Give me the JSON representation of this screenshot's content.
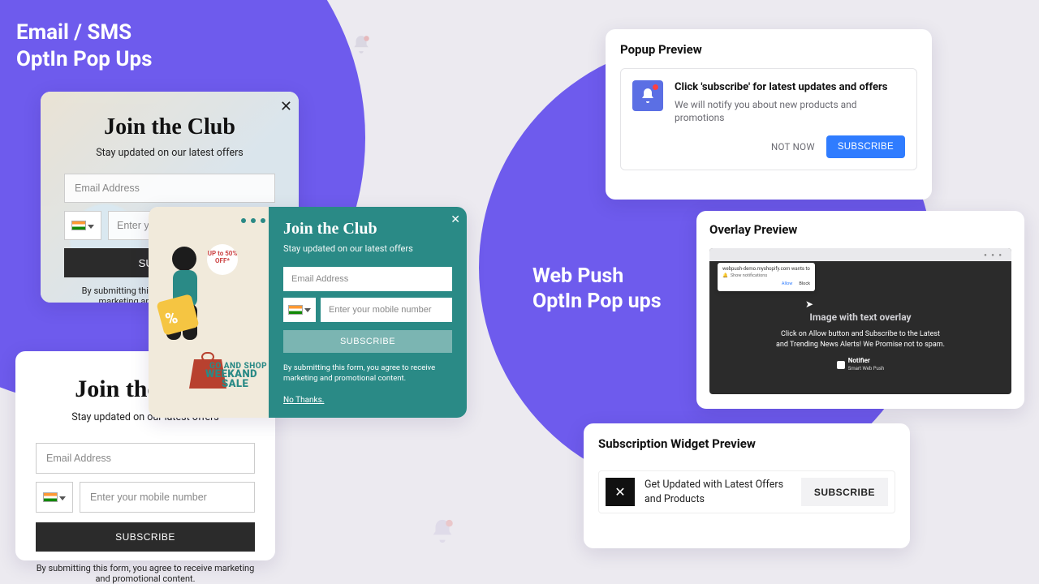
{
  "left_heading_l1": "Email / SMS",
  "left_heading_l2": "OptIn Pop Ups",
  "right_heading_l1": "Web Push",
  "right_heading_l2": "OptIn Pop ups",
  "popA": {
    "title": "Join the Club",
    "subtitle": "Stay updated on our latest offers",
    "email_ph": "Email Address",
    "phone_ph": "Enter your mobile number",
    "submit": "SUBSCRIBE",
    "terms": "By submitting this form, you agree to receive marketing and promotional content."
  },
  "popB": {
    "badge": "UP to 50% OFF*",
    "sale1": "GO AND SHOP",
    "sale2": "WEEKAND",
    "sale3": "SALE",
    "title": "Join the Club",
    "subtitle": "Stay updated on our latest offers",
    "email_ph": "Email Address",
    "phone_ph": "Enter your mobile number",
    "submit": "SUBSCRIBE",
    "terms": "By submitting this form, you agree to receive marketing and promotional content.",
    "nothanks": "No Thanks."
  },
  "popC": {
    "title": "Join the Club",
    "subtitle": "Stay updated on our latest offers",
    "email_ph": "Email Address",
    "phone_ph": "Enter your mobile number",
    "submit": "SUBSCRIBE",
    "terms": "By submitting this form, you agree to receive marketing and promotional content."
  },
  "prevA": {
    "heading": "Popup Preview",
    "title": "Click 'subscribe' for latest updates and offers",
    "sub": "We will notify you about new products and promotions",
    "notnow": "NOT NOW",
    "subscribe": "SUBSCRIBE"
  },
  "prevB": {
    "heading": "Overlay Preview",
    "browser_site": "webpush-demo.myshopify.com wants to",
    "browser_perm": "Show notifications",
    "allow": "Allow",
    "block": "Block",
    "overlay_head": "Image with text overlay",
    "overlay_sub": "Click on Allow button and Subscribe to the Latest and Trending News Alerts! We Promise not to spam.",
    "brand_name": "Notifier",
    "brand_tag": "Smart Web Push"
  },
  "prevC": {
    "heading": "Subscription Widget Preview",
    "msg": "Get Updated with Latest Offers and Products",
    "subscribe": "SUBSCRIBE"
  }
}
